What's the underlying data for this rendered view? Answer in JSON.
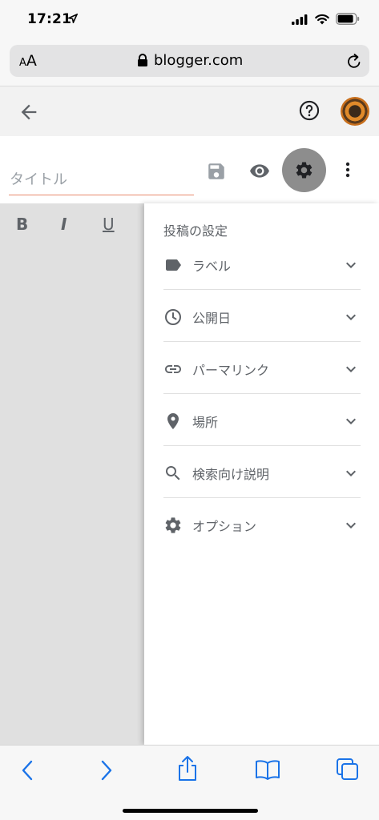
{
  "status_bar": {
    "time": "17:21"
  },
  "browser": {
    "text_size_small": "A",
    "text_size_large": "A",
    "url": "blogger.com"
  },
  "editor": {
    "title_placeholder": "タイトル",
    "format": {
      "bold": "B",
      "italic": "I",
      "underline": "U"
    }
  },
  "settings_panel": {
    "title": "投稿の設定",
    "items": [
      {
        "label": "ラベル",
        "icon": "label-icon"
      },
      {
        "label": "公開日",
        "icon": "clock-icon"
      },
      {
        "label": "パーマリンク",
        "icon": "link-icon"
      },
      {
        "label": "場所",
        "icon": "location-pin-icon"
      },
      {
        "label": "検索向け説明",
        "icon": "search-icon"
      },
      {
        "label": "オプション",
        "icon": "gear-icon"
      }
    ]
  },
  "colors": {
    "accent_underline": "#e8896b",
    "ios_blue": "#1a73e8",
    "icon_gray": "#5f6368",
    "settings_active_bg": "#8d8d8d"
  }
}
